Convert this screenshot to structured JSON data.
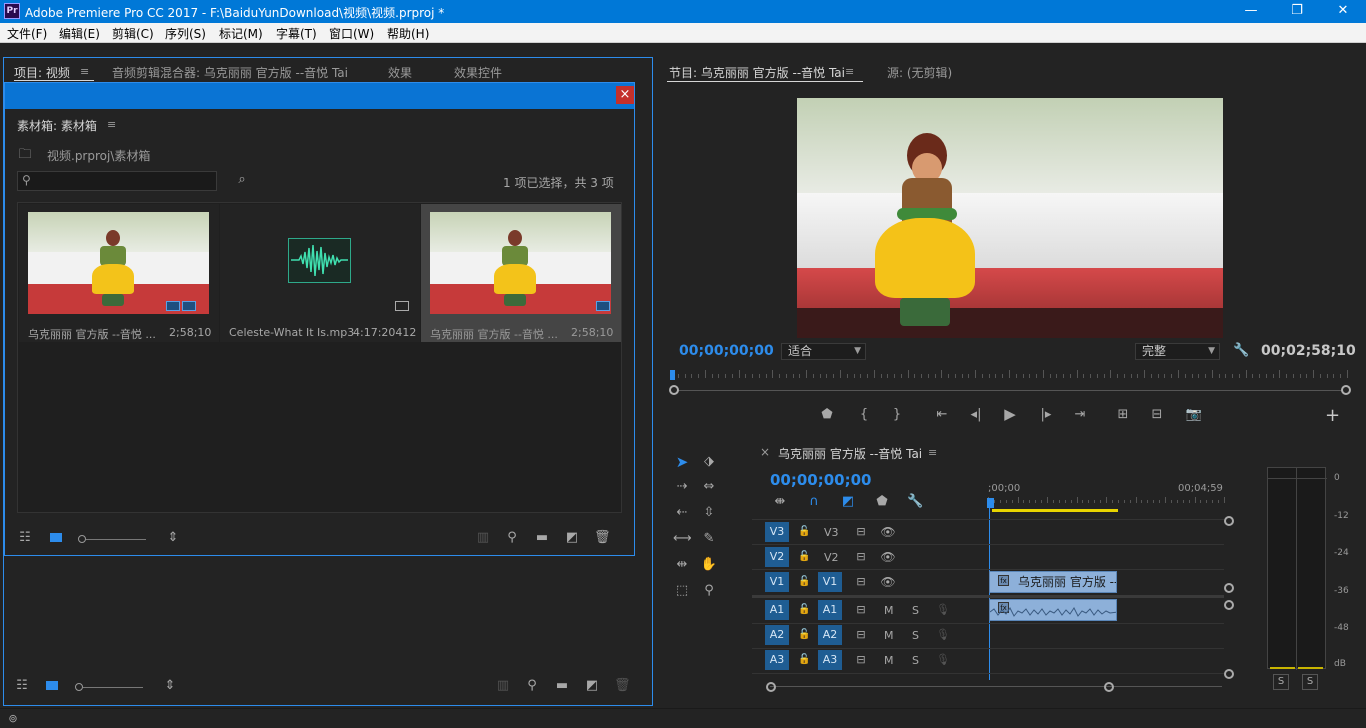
{
  "titlebar": {
    "logo": "Pr",
    "title": "Adobe Premiere Pro CC 2017 - F:\\BaiduYunDownload\\视频\\视频.prproj *",
    "minimize": "—",
    "restore": "❐",
    "close": "✕"
  },
  "menu": [
    "文件(F)",
    "编辑(E)",
    "剪辑(C)",
    "序列(S)",
    "标记(M)",
    "字幕(T)",
    "窗口(W)",
    "帮助(H)"
  ],
  "left_panel": {
    "tabs": [
      "项目: 视频",
      "音频剪辑混合器: 乌克丽丽 官方版 --音悦 Tai",
      "效果",
      "效果控件"
    ],
    "menu_icon": "≡"
  },
  "bin_window": {
    "close": "×",
    "title": "素材箱: 素材箱",
    "menu_icon": "≡",
    "path": "视频.prproj\\素材箱",
    "search_placeholder": "",
    "selection_info": "1 项已选择，共 3 项",
    "items": [
      {
        "name": "乌克丽丽 官方版 --音悦 Tai",
        "name_display": "乌克丽丽  官方版 --音悦 ...",
        "duration": "2;58;10",
        "type": "video",
        "selected": false
      },
      {
        "name": "Celeste-What It Is.mp3",
        "name_display": "Celeste-What It Is.mp3",
        "duration": "4:17:20412",
        "type": "audio",
        "selected": false
      },
      {
        "name": "乌克丽丽 官方版 --音悦 Tai",
        "name_display": "乌克丽丽  官方版 --音悦 ...",
        "duration": "2;58;10",
        "type": "sequence",
        "selected": true
      }
    ]
  },
  "program_monitor": {
    "tab_active": "节目: 乌克丽丽  官方版 --音悦 Tai",
    "tab_source": "源: (无剪辑)",
    "menu_icon": "≡",
    "timecode_current": "00;00;00;00",
    "fit": "适合",
    "quality": "完整",
    "timecode_duration": "00;02;58;10",
    "add_button": "+"
  },
  "tools": [
    "selection",
    "track-select-forward",
    "ripple-edit",
    "rolling-edit",
    "rate-stretch",
    "razor",
    "slip",
    "slide",
    "pen",
    "hand",
    "type",
    "zoom"
  ],
  "timeline": {
    "close": "×",
    "sequence_name": "乌克丽丽  官方版 --音悦 Tai",
    "menu_icon": "≡",
    "timecode": "00;00;00;00",
    "ruler_start": ";00;00",
    "ruler_end": "00;04;59",
    "video_tracks": [
      {
        "id": "V3",
        "source": "",
        "label": "V3"
      },
      {
        "id": "V2",
        "source": "",
        "label": "V2"
      },
      {
        "id": "V1",
        "source": "V1",
        "label": "V1"
      }
    ],
    "audio_tracks": [
      {
        "id": "A1",
        "source": "A1",
        "mute": "M",
        "solo": "S"
      },
      {
        "id": "A2",
        "source": "A2",
        "mute": "M",
        "solo": "S"
      },
      {
        "id": "A3",
        "source": "A3",
        "mute": "M",
        "solo": "S"
      }
    ],
    "clip_label": "乌克丽丽  官方版 --"
  },
  "audio_meter": {
    "scale": [
      "0",
      "-12",
      "-24",
      "-36",
      "-48",
      "dB"
    ],
    "solo_left": "S",
    "solo_right": "S"
  },
  "colors": {
    "accent_blue": "#2d8ceb",
    "titlebar": "#0078d7",
    "track_active": "#1f5d93",
    "clip": "#8db0d9"
  }
}
